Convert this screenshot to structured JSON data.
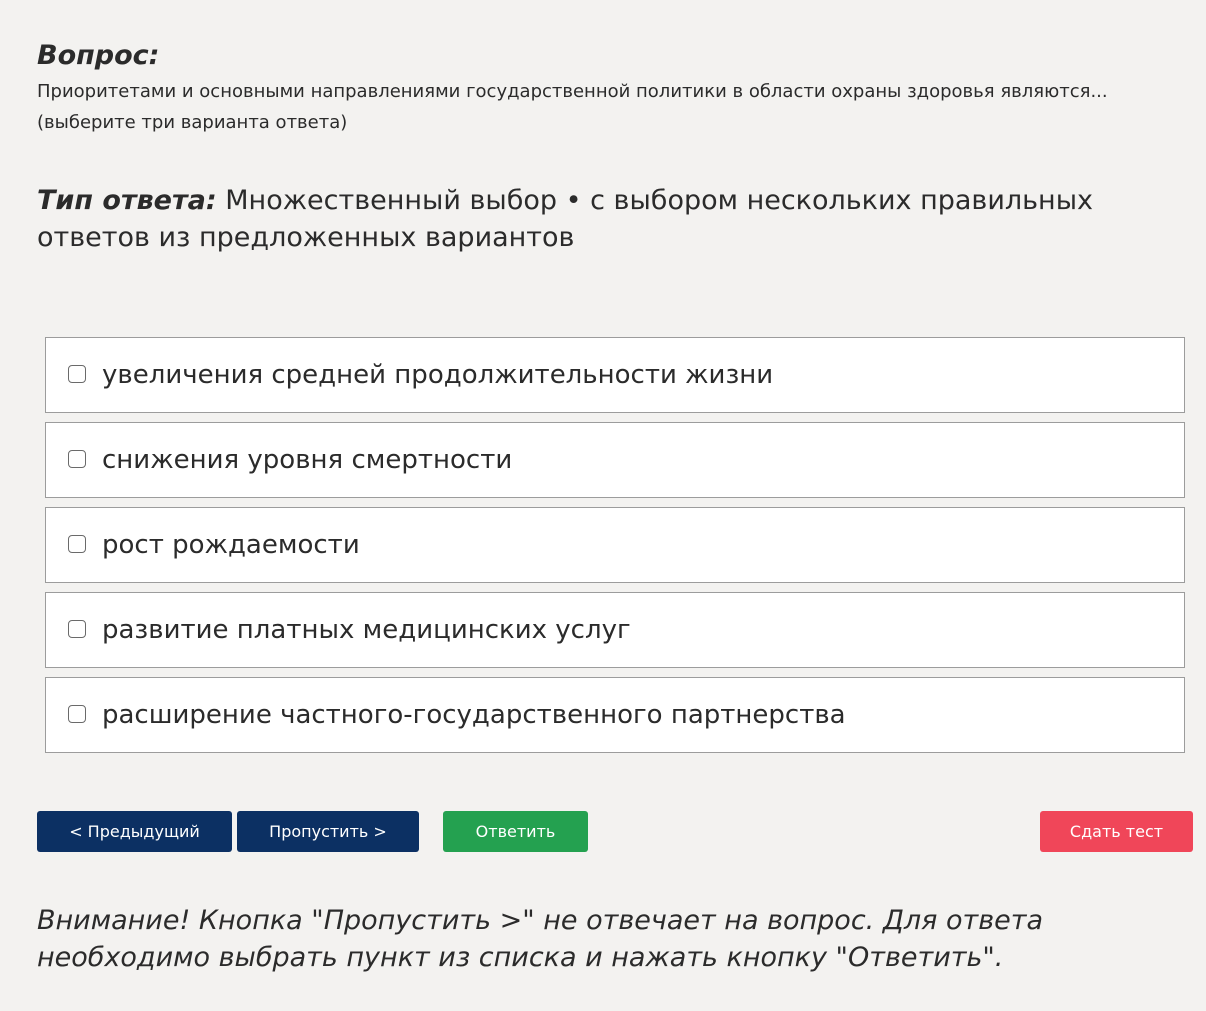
{
  "question": {
    "heading": "Вопрос:",
    "text_line1": "Приоритетами и основными направлениями государственной политики в области охраны здоровья являются...",
    "text_line2": "(выберите три варианта ответа)"
  },
  "answer_type": {
    "label": "Тип ответа:",
    "value": "Множественный выбор • с выбором нескольких правильных ответов из предложенных вариантов"
  },
  "options": [
    {
      "label": "увеличения средней продолжительности жизни",
      "checked": false
    },
    {
      "label": "снижения уровня смертности",
      "checked": false
    },
    {
      "label": "рост рождаемости",
      "checked": false
    },
    {
      "label": "развитие платных медицинских услуг",
      "checked": false
    },
    {
      "label": "расширение частного-государственного партнерства",
      "checked": false
    }
  ],
  "buttons": {
    "prev": "< Предыдущий",
    "skip": "Пропустить >",
    "answer": "Ответить",
    "submit": "Сдать тест"
  },
  "notice": "Внимание! Кнопка \"Пропустить >\" не отвечает на вопрос. Для ответа необходимо выбрать пункт из списка и нажать кнопку \"Ответить\".",
  "colors": {
    "background": "#f3f2f0",
    "nav_button": "#0c3063",
    "answer_button": "#24a150",
    "submit_button": "#f04659"
  }
}
